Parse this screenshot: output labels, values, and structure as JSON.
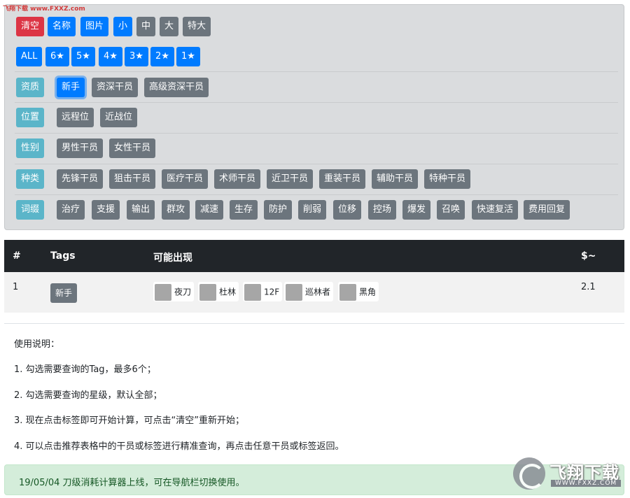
{
  "watermark": {
    "top_text": "飞翔下载 www.FXXZ.com",
    "logo_text": "飞翔下载",
    "logo_url": "WWW.FXXZ.COM"
  },
  "controls": {
    "clear": "清空",
    "name": "名称",
    "image": "图片",
    "small": "小",
    "medium": "中",
    "large": "大",
    "xlarge": "特大"
  },
  "stars": [
    "ALL",
    "6★",
    "5★",
    "4★",
    "3★",
    "2★",
    "1★"
  ],
  "filters": {
    "qualification": {
      "label": "资质",
      "options": [
        "新手",
        "资深干员",
        "高级资深干员"
      ],
      "active": "新手"
    },
    "position": {
      "label": "位置",
      "options": [
        "远程位",
        "近战位"
      ]
    },
    "gender": {
      "label": "性别",
      "options": [
        "男性干员",
        "女性干员"
      ]
    },
    "class": {
      "label": "种类",
      "options": [
        "先锋干员",
        "狙击干员",
        "医疗干员",
        "术师干员",
        "近卫干员",
        "重装干员",
        "辅助干员",
        "特种干员"
      ]
    },
    "affix": {
      "label": "词缀",
      "options": [
        "治疗",
        "支援",
        "输出",
        "群攻",
        "减速",
        "生存",
        "防护",
        "削弱",
        "位移",
        "控场",
        "爆发",
        "召唤",
        "快速复活",
        "费用回复"
      ]
    }
  },
  "table": {
    "headers": {
      "num": "#",
      "tags": "Tags",
      "possible": "可能出现",
      "price": "$~"
    },
    "rows": [
      {
        "num": "1",
        "tag": "新手",
        "operators": [
          "夜刀",
          "杜林",
          "12F",
          "巡林者",
          "黑角"
        ],
        "price": "2.1"
      }
    ]
  },
  "instructions": {
    "title": "使用说明：",
    "items": [
      "1. 勾选需要查询的Tag，最多6个；",
      "2. 勾选需要查询的星级，默认全部；",
      "3. 现在点击标签即可开始计算，可点击“清空”重新开始；",
      "4. 可以点击推荐表格中的干员或标签进行精准查询，再点击任意干员或标签返回。"
    ]
  },
  "notice": "19/05/04 刀级消耗计算器上线，可在导航栏切换使用。",
  "colors": {
    "danger": "#dc3545",
    "primary": "#007bff",
    "secondary": "#6c757d",
    "info": "#5bb5c9",
    "header_dark": "#212529",
    "alert_bg": "#d4edda"
  }
}
